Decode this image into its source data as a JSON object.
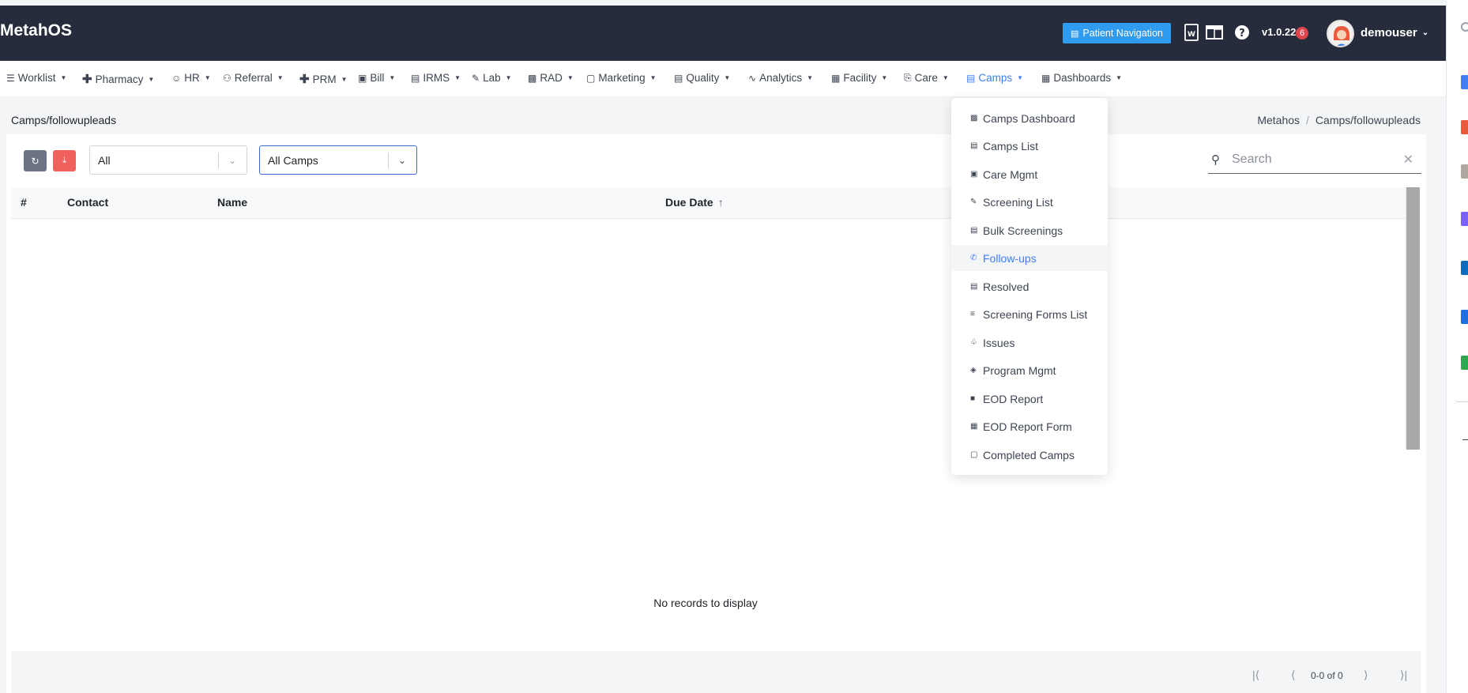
{
  "app": {
    "title": "MetahOS"
  },
  "header": {
    "patient_nav_label": "Patient Navigation",
    "version": "v1.0.22",
    "version_badge": "6",
    "username": "demouser"
  },
  "nav": {
    "items": [
      {
        "label": "Worklist",
        "icon": "list-icon"
      },
      {
        "label": "Pharmacy",
        "icon": "plus-icon"
      },
      {
        "label": "HR",
        "icon": "user-circle-icon"
      },
      {
        "label": "Referral",
        "icon": "users-icon"
      },
      {
        "label": "PRM",
        "icon": "plus-icon"
      },
      {
        "label": "Bill",
        "icon": "money-icon"
      },
      {
        "label": "IRMS",
        "icon": "id-card-icon"
      },
      {
        "label": "Lab",
        "icon": "pipette-icon"
      },
      {
        "label": "RAD",
        "icon": "film-icon"
      },
      {
        "label": "Marketing",
        "icon": "bag-icon"
      },
      {
        "label": "Quality",
        "icon": "id-card-icon"
      },
      {
        "label": "Analytics",
        "icon": "pulse-icon"
      },
      {
        "label": "Facility",
        "icon": "building-icon"
      },
      {
        "label": "Care",
        "icon": "bed-icon"
      },
      {
        "label": "Camps",
        "icon": "briefcase-icon"
      },
      {
        "label": "Dashboards",
        "icon": "grid-icon"
      }
    ]
  },
  "breadcrumb": {
    "page": "Camps/followupleads",
    "root": "Metahos",
    "separator": "/",
    "current": "Camps/followupleads"
  },
  "filters": {
    "status_value": "All",
    "camp_value": "All Camps"
  },
  "search": {
    "placeholder": "Search"
  },
  "table": {
    "columns": [
      "#",
      "Contact",
      "Name",
      "Due Date"
    ],
    "empty_text": "No records to display"
  },
  "pagination": {
    "info": "0-0 of 0"
  },
  "camps_menu": {
    "items": [
      {
        "label": "Camps Dashboard",
        "icon": "image-icon"
      },
      {
        "label": "Camps List",
        "icon": "briefcase-icon"
      },
      {
        "label": "Care Mgmt",
        "icon": "briefcase-filled-icon"
      },
      {
        "label": "Screening List",
        "icon": "pipette-icon"
      },
      {
        "label": "Bulk Screenings",
        "icon": "list-box-icon"
      },
      {
        "label": "Follow-ups",
        "icon": "phone-icon"
      },
      {
        "label": "Resolved",
        "icon": "briefcase-check-icon"
      },
      {
        "label": "Screening Forms List",
        "icon": "sliders-icon"
      },
      {
        "label": "Issues",
        "icon": "megaphone-icon"
      },
      {
        "label": "Program Mgmt",
        "icon": "layers-icon"
      },
      {
        "label": "EOD Report",
        "icon": "book-icon"
      },
      {
        "label": "EOD Report Form",
        "icon": "trash-icon"
      },
      {
        "label": "Completed Camps",
        "icon": "file-icon"
      }
    ],
    "active_index": 5
  },
  "colors": {
    "header_bg": "#262c3b",
    "accent": "#3e7ff7",
    "patient_nav_bg": "#2f9cf2",
    "refresh_btn": "#6b7385",
    "export_btn": "#f0615e",
    "badge": "#e0454d"
  }
}
